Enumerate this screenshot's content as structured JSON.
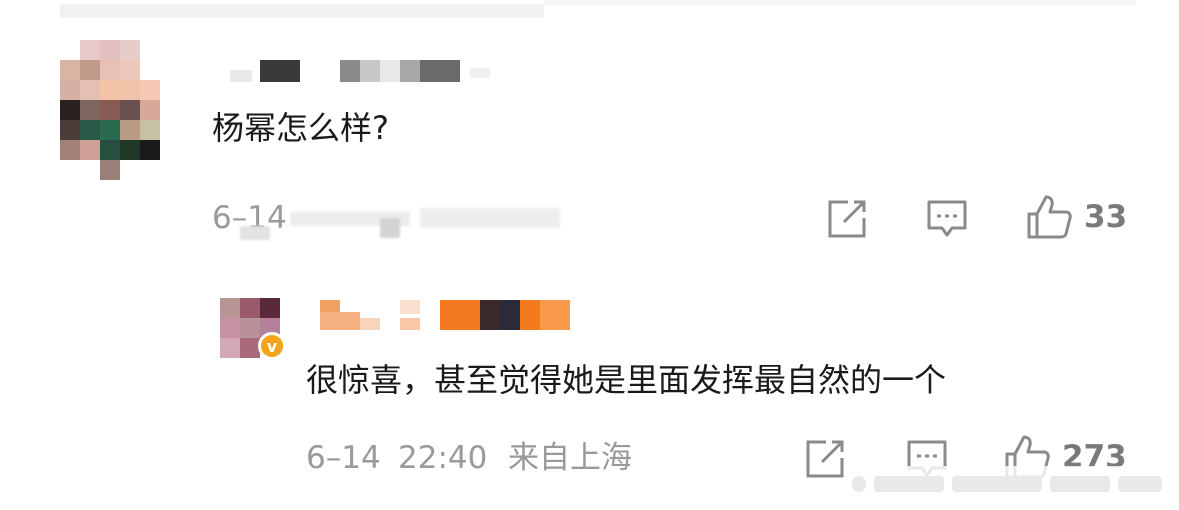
{
  "comment": {
    "text": "杨幂怎么样?",
    "meta_visible": "6–14",
    "likes": "33",
    "icons": [
      "share-icon",
      "comment-icon",
      "like-icon"
    ]
  },
  "reply": {
    "text": "很惊喜，甚至觉得她是里面发挥最自然的一个",
    "date": "6–14",
    "time": "22:40",
    "location": "来自上海",
    "likes": "273",
    "badge": "v",
    "icons": [
      "share-icon",
      "comment-icon",
      "like-icon"
    ]
  },
  "colors": {
    "text": "#1a1a1a",
    "meta": "#9a9a9a",
    "icon": "#8a8a8a",
    "badge": "#f7a319",
    "name_orange": "#f47a1f"
  }
}
